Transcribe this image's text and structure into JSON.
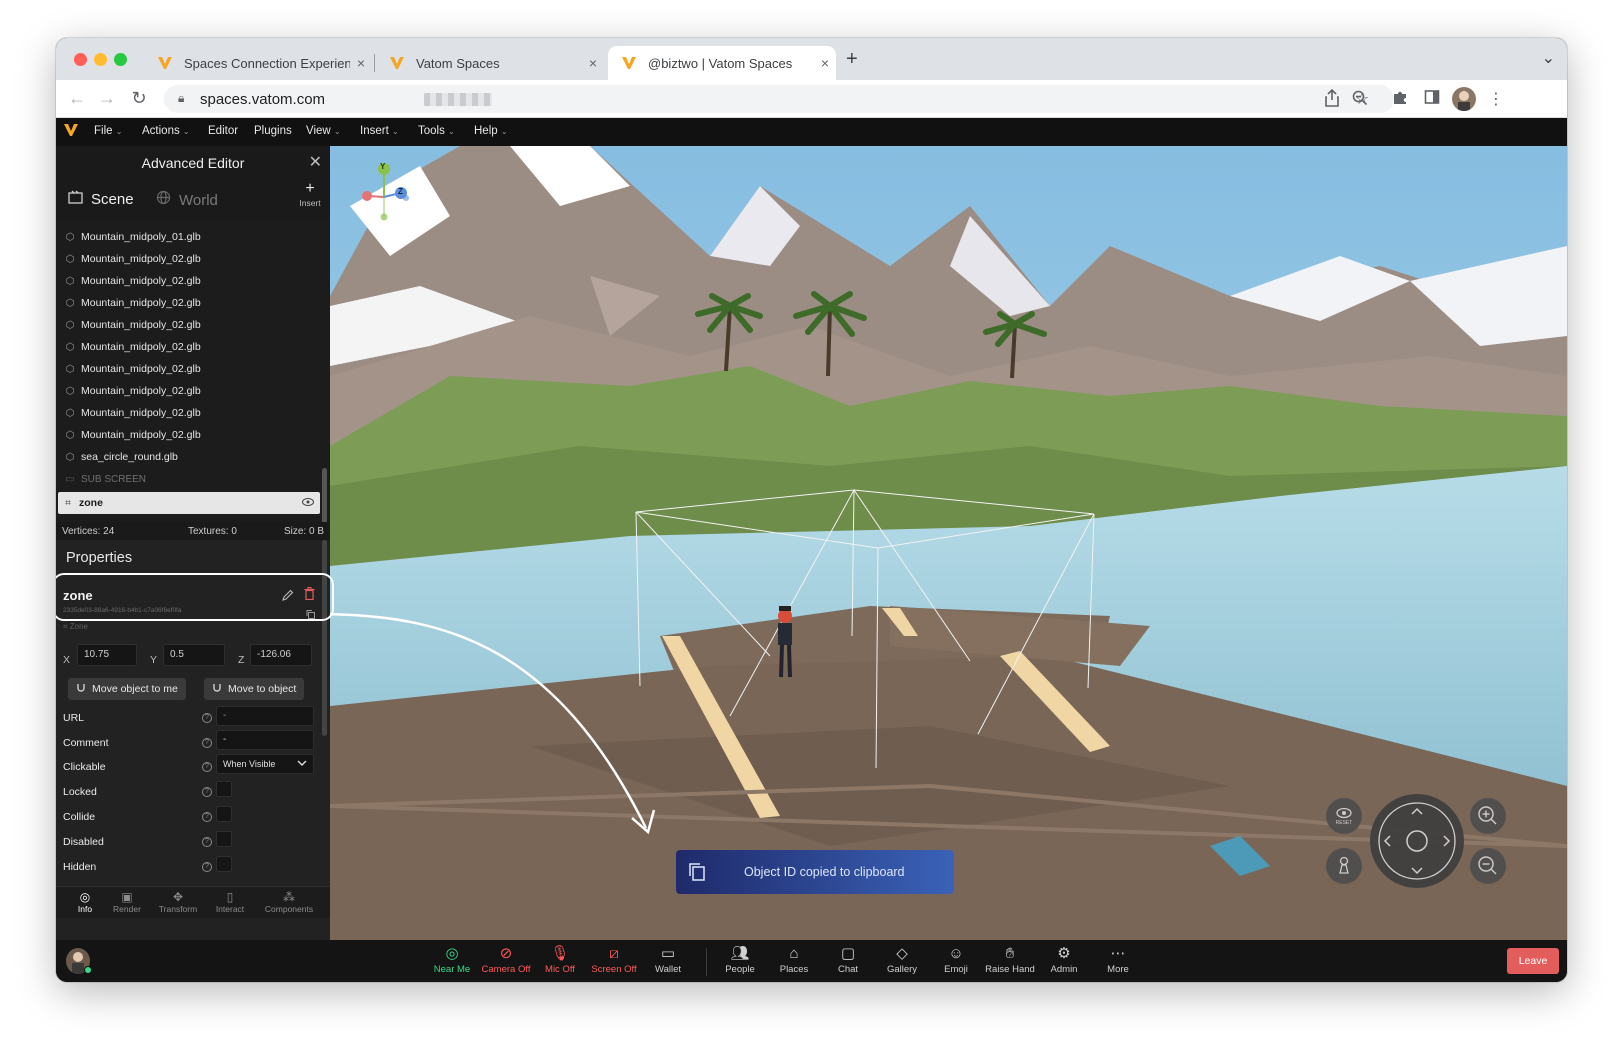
{
  "browser": {
    "tabs": [
      {
        "title": "Spaces Connection Experience",
        "close": "×"
      },
      {
        "title": "Vatom Spaces",
        "close": "×"
      },
      {
        "title": "@biztwo | Vatom Spaces",
        "close": "×"
      }
    ],
    "new_tab": "+",
    "url": "spaces.vatom.com",
    "tab_menu": "⌄"
  },
  "menubar": {
    "items": [
      "File",
      "Actions",
      "Editor",
      "Plugins",
      "View",
      "Insert",
      "Tools",
      "Help"
    ],
    "chevron": "⌄"
  },
  "editor": {
    "title": "Advanced Editor",
    "close": "✕",
    "tabs": {
      "scene": "Scene",
      "world": "World"
    },
    "insert_label": "Insert",
    "insert_plus": "+",
    "tree_items": [
      "Mountain_midpoly_01.glb",
      "Mountain_midpoly_02.glb",
      "Mountain_midpoly_02.glb",
      "Mountain_midpoly_02.glb",
      "Mountain_midpoly_02.glb",
      "Mountain_midpoly_02.glb",
      "Mountain_midpoly_02.glb",
      "Mountain_midpoly_02.glb",
      "Mountain_midpoly_02.glb",
      "Mountain_midpoly_02.glb",
      "sea_circle_round.glb"
    ],
    "sub_screen": "SUB SCREEN",
    "selected_item": "zone",
    "stats": {
      "vertices": "Vertices: 24",
      "textures": "Textures: 0",
      "size": "Size: 0 B"
    },
    "properties_title": "Properties",
    "object": {
      "name": "zone",
      "id": "2335de03-88a6-4916-b4b1-c7a06f8ef0fa",
      "type": "Zone"
    },
    "position": {
      "x_label": "X",
      "x": "10.75",
      "y_label": "Y",
      "y": "0.5",
      "z_label": "Z",
      "z": "-126.06"
    },
    "buttons": {
      "move_to_me": "Move object to me",
      "move_to_object": "Move to object"
    },
    "fields": {
      "url": {
        "label": "URL",
        "value": "-"
      },
      "comment": {
        "label": "Comment",
        "value": "-"
      },
      "clickable": {
        "label": "Clickable",
        "value": "When Visible"
      },
      "locked": {
        "label": "Locked"
      },
      "collide": {
        "label": "Collide"
      },
      "disabled": {
        "label": "Disabled"
      },
      "hidden": {
        "label": "Hidden"
      }
    },
    "bottom_nav": [
      "Info",
      "Render",
      "Transform",
      "Interact",
      "Components"
    ]
  },
  "viewport": {
    "gizmo": {
      "y": "Y",
      "z": "Z"
    },
    "reset_label": "RESET",
    "toast": "Object ID copied to clipboard"
  },
  "toolbar": {
    "items": [
      {
        "label": "Near Me"
      },
      {
        "label": "Camera Off"
      },
      {
        "label": "Mic Off"
      },
      {
        "label": "Screen Off"
      },
      {
        "label": "Wallet"
      },
      {
        "label": "People"
      },
      {
        "label": "Places"
      },
      {
        "label": "Chat"
      },
      {
        "label": "Gallery"
      },
      {
        "label": "Emoji"
      },
      {
        "label": "Raise Hand"
      },
      {
        "label": "Admin"
      },
      {
        "label": "More"
      }
    ],
    "leave": "Leave"
  },
  "colors": {
    "accent_orange": "#f5a623",
    "danger": "#e35d5d",
    "off_red": "#ff5a5a",
    "on_green": "#39d98a",
    "toast_start": "#1f2a6a",
    "toast_end": "#3a62b8"
  }
}
